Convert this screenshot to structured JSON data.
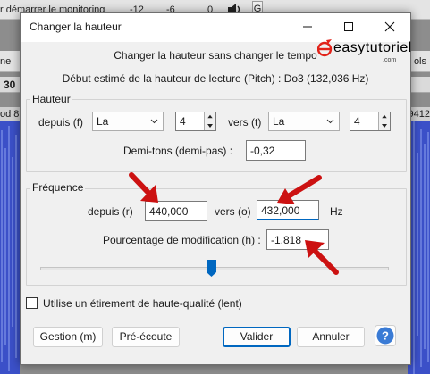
{
  "background": {
    "toolbar_text": "r démarrer le monitoring",
    "meter_ticks": [
      "-12",
      "-6",
      "0"
    ],
    "mini_button": "G",
    "row2_left": "ne",
    "row2_right": "ols",
    "ruler_left": "30",
    "track_left": "od 8",
    "track_right": "9412"
  },
  "dialog": {
    "title": "Changer la hauteur",
    "heading": "Changer la hauteur sans changer le tempo",
    "pitch_estimate": "Début estimé de la hauteur de lecture (Pitch) : Do3 (132,036 Hz)",
    "watermark": {
      "text": "easytutoriel",
      "sub": ".com",
      "brand_color": "#e2231a"
    },
    "pitch_group": {
      "label": "Hauteur",
      "from_label": "depuis (f)",
      "from_note": "La",
      "from_octave": "4",
      "to_label": "vers (t)",
      "to_note": "La",
      "to_octave": "4",
      "semitones_label": "Demi-tons (demi-pas) :",
      "semitones_value": "-0,32"
    },
    "freq_group": {
      "label": "Fréquence",
      "from_label": "depuis (r)",
      "from_value": "440,000",
      "to_label": "vers (o)",
      "to_value": "432,000",
      "unit": "Hz",
      "percent_label": "Pourcentage de modification (h) :",
      "percent_value": "-1,818",
      "slider_fraction": 0.49
    },
    "high_quality_label": "Utilise un étirement de haute-qualité (lent)",
    "high_quality_checked": false,
    "buttons": {
      "manage": "Gestion (m)",
      "preview": "Pré-écoute",
      "apply": "Valider",
      "cancel": "Annuler",
      "help": "?"
    },
    "accent_color": "#0067c0",
    "annotation_color": "#cc1111"
  }
}
